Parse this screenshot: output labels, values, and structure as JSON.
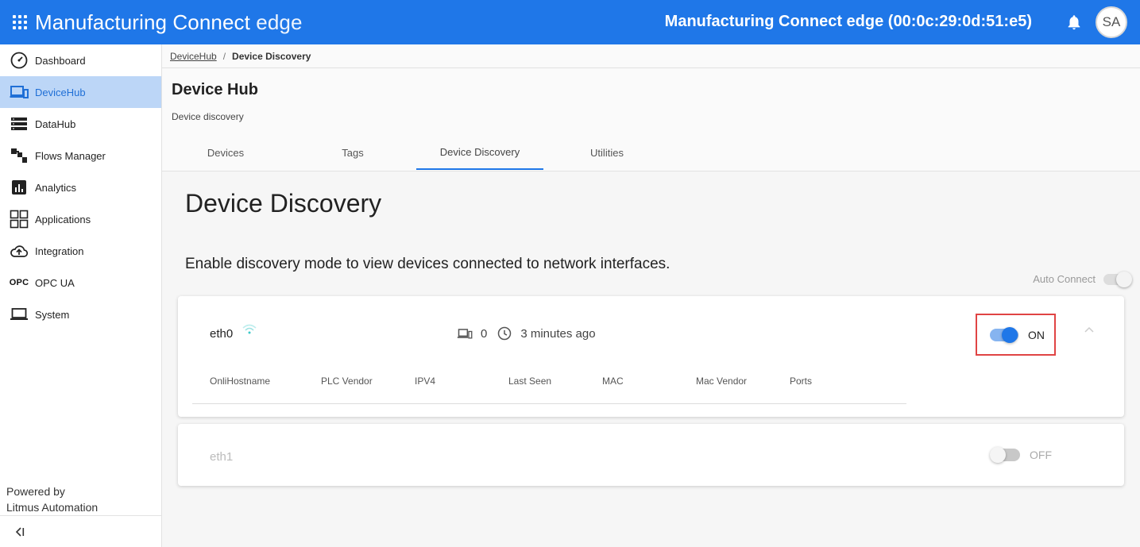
{
  "topbar": {
    "brand_main": "Manufacturing Connect",
    "brand_suffix": "edge",
    "device_title": "Manufacturing Connect edge (00:0c:29:0d:51:e5)",
    "avatar_initials": "SA",
    "color": "#1f77e8"
  },
  "sidebar": {
    "items": [
      {
        "label": "Dashboard",
        "icon": "speedometer-icon"
      },
      {
        "label": "DeviceHub",
        "icon": "devices-icon",
        "active": true
      },
      {
        "label": "DataHub",
        "icon": "server-icon"
      },
      {
        "label": "Flows Manager",
        "icon": "flow-icon"
      },
      {
        "label": "Analytics",
        "icon": "analytics-icon"
      },
      {
        "label": "Applications",
        "icon": "grid-icon"
      },
      {
        "label": "Integration",
        "icon": "cloud-upload-icon"
      },
      {
        "label": "OPC UA",
        "icon": "opc-icon",
        "icon_text": "OPC"
      },
      {
        "label": "System",
        "icon": "laptop-icon"
      }
    ],
    "powered_line1": "Powered by",
    "powered_line2": "Litmus Automation"
  },
  "breadcrumb": {
    "parent": "DeviceHub",
    "separator": "/",
    "current": "Device Discovery"
  },
  "header": {
    "title": "Device Hub",
    "subtitle": "Device discovery",
    "tabs": [
      {
        "label": "Devices"
      },
      {
        "label": "Tags"
      },
      {
        "label": "Device Discovery",
        "active": true
      },
      {
        "label": "Utilities"
      }
    ]
  },
  "content": {
    "page_title": "Device Discovery",
    "enable_text": "Enable discovery mode to view devices connected to network interfaces.",
    "auto_connect_label": "Auto Connect"
  },
  "interfaces": [
    {
      "name": "eth0",
      "device_count": "0",
      "last_seen": "3 minutes ago",
      "toggle_label": "ON",
      "columns": [
        "OnliHostname",
        "PLC Vendor",
        "IPV4",
        "Last Seen",
        "MAC",
        "Mac Vendor",
        "Ports"
      ]
    },
    {
      "name": "eth1",
      "toggle_label": "OFF"
    }
  ],
  "colors": {
    "accent": "#1f77e8",
    "active_nav_bg": "#bcd6f7",
    "highlight_border": "#e04444",
    "wifi": "#3cc9c9"
  }
}
